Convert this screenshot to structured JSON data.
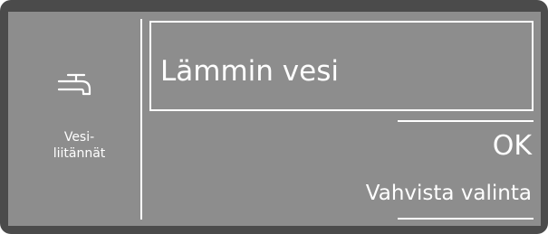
{
  "side_panel": {
    "icon": "water-tap-icon",
    "label_line1": "Vesi-",
    "label_line2": "liitännät"
  },
  "selection": {
    "value": "Lämmin vesi"
  },
  "action": {
    "ok_label": "OK",
    "confirm_label": "Vahvista valinta"
  },
  "colors": {
    "bezel": "#4b4b4b",
    "screen": "#8d8d8d",
    "foreground": "#ffffff"
  }
}
